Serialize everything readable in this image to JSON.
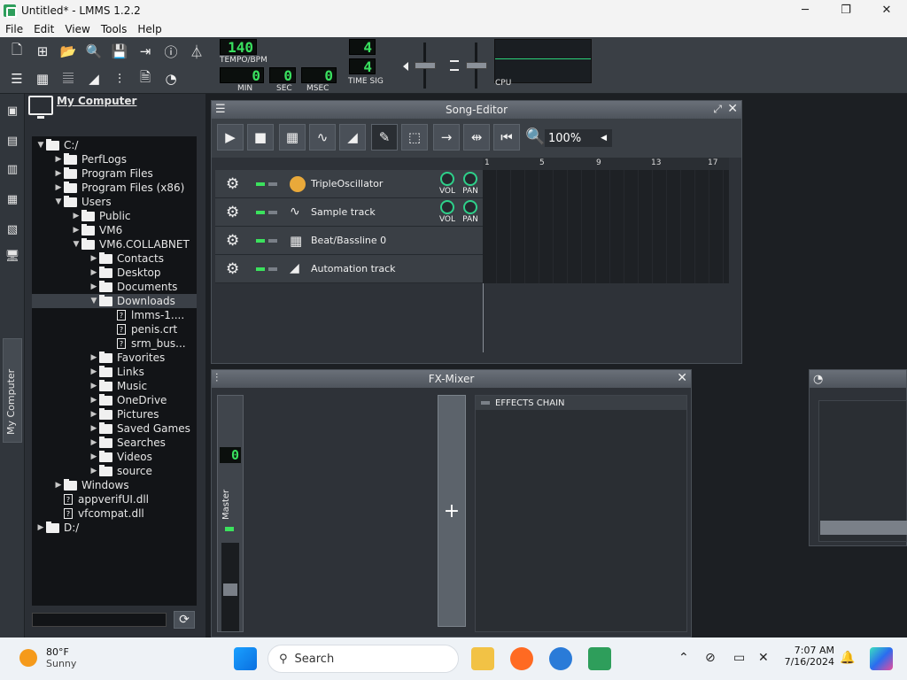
{
  "window": {
    "title": "Untitled* - LMMS 1.2.2",
    "minimize": "─",
    "maximize": "❐",
    "close": "✕"
  },
  "menu": [
    "File",
    "Edit",
    "View",
    "Tools",
    "Help"
  ],
  "transport": {
    "tempo": "140",
    "tempo_label": "TEMPO/BPM",
    "min": "0",
    "min_label": "MIN",
    "sec": "0",
    "sec_label": "SEC",
    "msec": "0",
    "msec_label": "MSEC",
    "timesig_num": "4",
    "timesig_den": "4",
    "timesig_label": "TIME SIG",
    "cpu_label": "CPU"
  },
  "browser": {
    "title": "My Computer",
    "tab_label": "My Computer",
    "tree": [
      {
        "label": "C:/",
        "type": "folder",
        "depth": 0,
        "expanded": true
      },
      {
        "label": "PerfLogs",
        "type": "folder",
        "depth": 1,
        "expanded": false
      },
      {
        "label": "Program Files",
        "type": "folder",
        "depth": 1,
        "expanded": false
      },
      {
        "label": "Program Files (x86)",
        "type": "folder",
        "depth": 1,
        "expanded": false
      },
      {
        "label": "Users",
        "type": "folder",
        "depth": 1,
        "expanded": true
      },
      {
        "label": "Public",
        "type": "folder",
        "depth": 2,
        "expanded": false
      },
      {
        "label": "VM6",
        "type": "folder",
        "depth": 2,
        "expanded": false
      },
      {
        "label": "VM6.COLLABNET",
        "type": "folder",
        "depth": 2,
        "expanded": true
      },
      {
        "label": "Contacts",
        "type": "folder",
        "depth": 3,
        "expanded": false
      },
      {
        "label": "Desktop",
        "type": "folder",
        "depth": 3,
        "expanded": false
      },
      {
        "label": "Documents",
        "type": "folder",
        "depth": 3,
        "expanded": false
      },
      {
        "label": "Downloads",
        "type": "folder",
        "depth": 3,
        "expanded": true,
        "selected": true
      },
      {
        "label": "lmms-1....",
        "type": "file",
        "depth": 4
      },
      {
        "label": "penis.crt",
        "type": "file",
        "depth": 4
      },
      {
        "label": "srm_bus...",
        "type": "file",
        "depth": 4
      },
      {
        "label": "Favorites",
        "type": "folder",
        "depth": 3,
        "expanded": false
      },
      {
        "label": "Links",
        "type": "folder",
        "depth": 3,
        "expanded": false
      },
      {
        "label": "Music",
        "type": "folder",
        "depth": 3,
        "expanded": false
      },
      {
        "label": "OneDrive",
        "type": "folder",
        "depth": 3,
        "expanded": false
      },
      {
        "label": "Pictures",
        "type": "folder",
        "depth": 3,
        "expanded": false
      },
      {
        "label": "Saved Games",
        "type": "folder",
        "depth": 3,
        "expanded": false
      },
      {
        "label": "Searches",
        "type": "folder",
        "depth": 3,
        "expanded": false
      },
      {
        "label": "Videos",
        "type": "folder",
        "depth": 3,
        "expanded": false
      },
      {
        "label": "source",
        "type": "folder",
        "depth": 3,
        "expanded": false
      },
      {
        "label": "Windows",
        "type": "folder",
        "depth": 1,
        "expanded": false
      },
      {
        "label": "appverifUI.dll",
        "type": "file",
        "depth": 1
      },
      {
        "label": "vfcompat.dll",
        "type": "file",
        "depth": 1
      },
      {
        "label": "D:/",
        "type": "folder",
        "depth": 0,
        "expanded": false
      }
    ]
  },
  "song_editor": {
    "title": "Song-Editor",
    "zoom": "100%",
    "timeline": [
      "1",
      "5",
      "9",
      "13",
      "17"
    ],
    "tracks": [
      {
        "name": "TripleOscillator",
        "icon": "triple-oscillator-icon",
        "has_knobs": true
      },
      {
        "name": "Sample track",
        "icon": "waveform-icon",
        "has_knobs": true
      },
      {
        "name": "Beat/Bassline 0",
        "icon": "beat-grid-icon",
        "has_knobs": false
      },
      {
        "name": "Automation track",
        "icon": "automation-ramp-icon",
        "has_knobs": false
      }
    ],
    "knob_labels": {
      "vol": "VOL",
      "pan": "PAN"
    }
  },
  "fx_mixer": {
    "title": "FX-Mixer",
    "master_label": "Master",
    "master_value": "0",
    "add_label": "+",
    "effects_chain_label": "EFFECTS CHAIN"
  },
  "taskbar": {
    "temp": "80°F",
    "condition": "Sunny",
    "search_placeholder": "Search",
    "time": "7:07 AM",
    "date": "7/16/2024"
  }
}
